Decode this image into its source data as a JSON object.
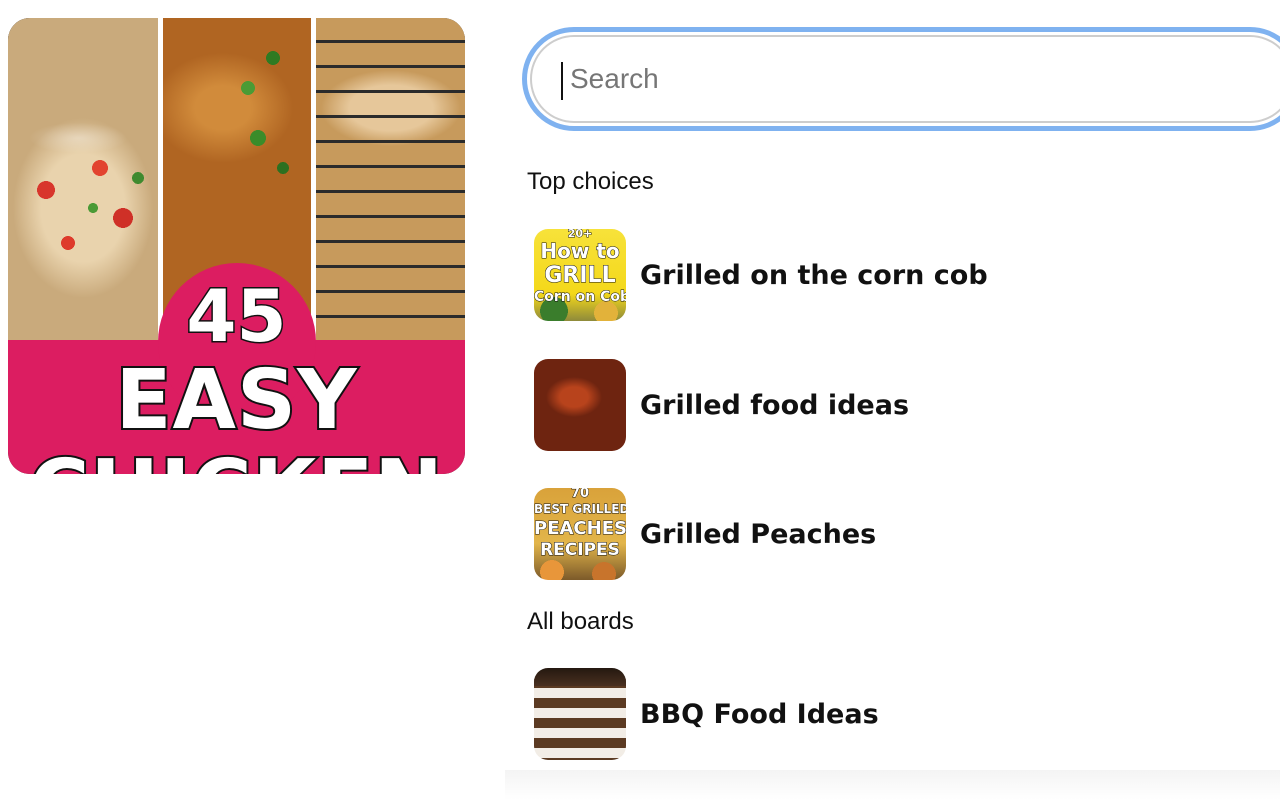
{
  "pin_preview": {
    "number": "45",
    "line1": "EASY",
    "line2": "CHICKEN",
    "banner_color": "#dc1d61"
  },
  "search": {
    "placeholder": "Search",
    "value": "",
    "focus_ring_color": "#7fb2f0"
  },
  "sections": {
    "top_choices_label": "Top choices",
    "all_boards_label": "All boards"
  },
  "top_choices": [
    {
      "name": "Grilled on the corn cob",
      "thumb_text": [
        "20+",
        "How to",
        "GRILL",
        "Corn on Cob"
      ]
    },
    {
      "name": "Grilled food ideas"
    },
    {
      "name": "Grilled Peaches",
      "thumb_text": [
        "70",
        "BEST GRILLED",
        "PEACHES",
        "RECIPES"
      ]
    }
  ],
  "all_boards": [
    {
      "name": "BBQ Food Ideas"
    }
  ]
}
